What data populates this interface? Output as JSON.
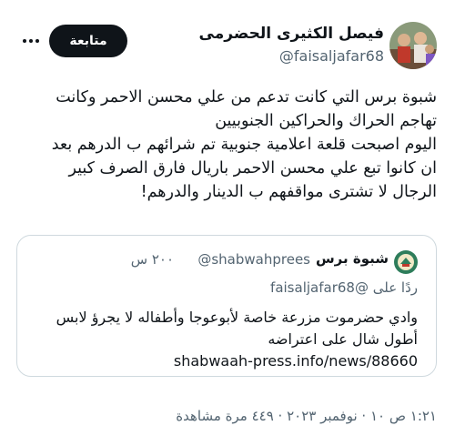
{
  "author": {
    "display_name": "فيصل الكثيرى الحضرمى",
    "handle": "@faisaljafar68",
    "avatar_icon": "group-photo-avatar"
  },
  "header": {
    "follow_label": "متابعة",
    "more_icon": "more-horizontal-icon"
  },
  "tweet": {
    "lines": [
      "شبوة برس التي كانت تدعم من علي محسن الاحمر وكانت",
      "تهاجم الحراك والحراكين الجنوبيين",
      "اليوم اصبحت قلعة اعلامية جنوبية تم شرائهم ب الدرهم بعد",
      "ان كانوا تبع علي محسن الاحمر باريال  فارق الصرف كبير",
      "الرجال لا تشترى مواقفهم ب الدينار والدرهم!"
    ]
  },
  "quote": {
    "display_name": "شبوة برس",
    "handle": "@shabwahprees",
    "time": "٢٠٠ س",
    "reply_to": "ردًا على @faisaljafar68",
    "lines": [
      "وادي حضرموت مزرعة خاصة لأبوعوجا وأطفاله لا يجرؤ لابس",
      "أطول شال على اعتراضه"
    ],
    "link": "shabwaah-press.info/news/88660",
    "avatar_icon": "shabwah-logo-icon"
  },
  "footer": {
    "meta": "١:٢١ ص ١٠ · نوفمبر ٢٠٢٣ · ٤٤٩ مرة مشاهدة"
  },
  "colors": {
    "text": "#0f1419",
    "secondary": "#536471",
    "border": "#cfd9de",
    "follow_bg": "#0f1419"
  }
}
